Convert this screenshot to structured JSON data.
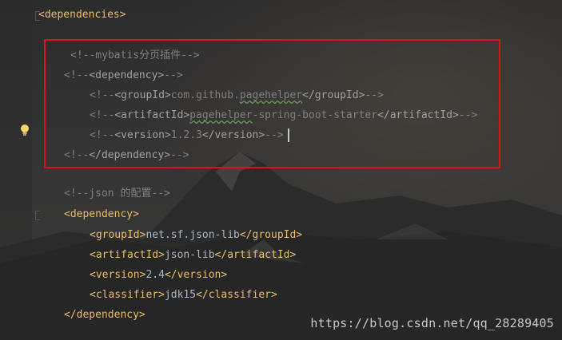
{
  "editor": {
    "lines": [
      {
        "indent": "",
        "parts": [
          {
            "t": "tag",
            "v": "<dependencies>"
          }
        ]
      },
      {
        "indent": "  ",
        "parts": [
          {
            "t": "cmt",
            "v": "<!--mybatis分页插件-->"
          }
        ]
      },
      {
        "indent": "",
        "parts": [
          {
            "t": "cmt",
            "v": "<!--"
          },
          {
            "t": "cmtag",
            "v": "<dependency>"
          },
          {
            "t": "cmt",
            "v": "-->"
          }
        ]
      },
      {
        "indent": "    ",
        "parts": [
          {
            "t": "cmt",
            "v": "<!--"
          },
          {
            "t": "cmtag",
            "v": "<groupId>"
          },
          {
            "t": "cmt",
            "v": "com.github."
          },
          {
            "t": "squig",
            "v": "pagehelper"
          },
          {
            "t": "cmtag",
            "v": "</groupId>"
          },
          {
            "t": "cmt",
            "v": "-->"
          }
        ]
      },
      {
        "indent": "    ",
        "parts": [
          {
            "t": "cmt",
            "v": "<!--"
          },
          {
            "t": "cmtag",
            "v": "<artifactId>"
          },
          {
            "t": "squig",
            "v": "pagehelper"
          },
          {
            "t": "cmt",
            "v": "-spring-boot-starter"
          },
          {
            "t": "cmtag",
            "v": "</artifactId>"
          },
          {
            "t": "cmt",
            "v": "-->"
          }
        ]
      },
      {
        "indent": "    ",
        "parts": [
          {
            "t": "cmt",
            "v": "<!--"
          },
          {
            "t": "cmtag",
            "v": "<version>"
          },
          {
            "t": "cmt",
            "v": "1.2.3"
          },
          {
            "t": "cmtag",
            "v": "</version>"
          },
          {
            "t": "cmt",
            "v": "-->"
          }
        ]
      },
      {
        "indent": "",
        "parts": [
          {
            "t": "cmt",
            "v": "<!--"
          },
          {
            "t": "cmtag",
            "v": "</dependency>"
          },
          {
            "t": "cmt",
            "v": "-->"
          }
        ]
      },
      {
        "indent": "",
        "parts": [
          {
            "t": "cmt",
            "v": "<!--json 的配置-->"
          }
        ]
      },
      {
        "indent": "",
        "parts": [
          {
            "t": "tag",
            "v": "<dependency>"
          }
        ]
      },
      {
        "indent": "    ",
        "parts": [
          {
            "t": "tag",
            "v": "<groupId>"
          },
          {
            "t": "txt",
            "v": "net.sf.json-lib"
          },
          {
            "t": "tag",
            "v": "</groupId>"
          }
        ]
      },
      {
        "indent": "    ",
        "parts": [
          {
            "t": "tag",
            "v": "<artifactId>"
          },
          {
            "t": "txt",
            "v": "json-lib"
          },
          {
            "t": "tag",
            "v": "</artifactId>"
          }
        ]
      },
      {
        "indent": "    ",
        "parts": [
          {
            "t": "tag",
            "v": "<version>"
          },
          {
            "t": "txt",
            "v": "2.4"
          },
          {
            "t": "tag",
            "v": "</version>"
          }
        ]
      },
      {
        "indent": "    ",
        "parts": [
          {
            "t": "tag",
            "v": "<classifier>"
          },
          {
            "t": "txt",
            "v": "jdk15"
          },
          {
            "t": "tag",
            "v": "</classifier>"
          }
        ]
      },
      {
        "indent": "",
        "parts": [
          {
            "t": "tag",
            "v": "</dependency>"
          }
        ]
      }
    ]
  },
  "icons": {
    "gutter": "lightbulb-icon"
  },
  "colors": {
    "highlight_box": "#e0101a",
    "tag": "#e8bf6a",
    "comment": "#808080",
    "text": "#a9b7c6"
  },
  "watermark": "https://blog.csdn.net/qq_28289405"
}
